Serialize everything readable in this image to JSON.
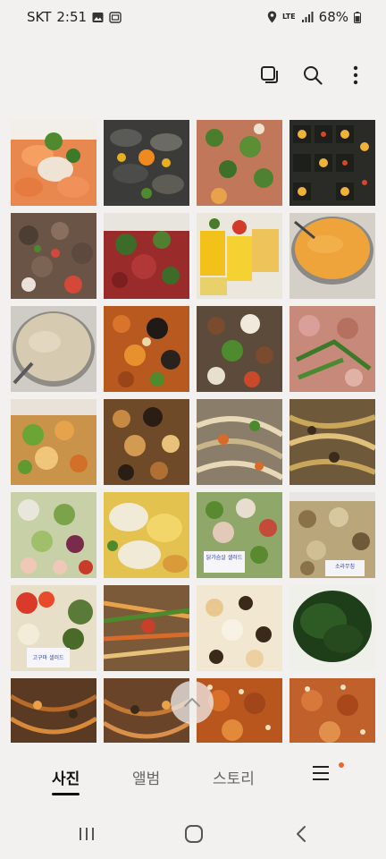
{
  "status": {
    "carrier": "SKT",
    "time": "2:51",
    "network": "LTE",
    "battery": "68%"
  },
  "toolbar": {
    "icons": [
      "select-icon",
      "search-icon",
      "more-options-icon"
    ]
  },
  "photos": [
    {
      "labels": []
    },
    {
      "labels": []
    },
    {
      "labels": []
    },
    {
      "labels": []
    },
    {
      "labels": []
    },
    {
      "labels": []
    },
    {
      "labels": []
    },
    {
      "labels": []
    },
    {
      "labels": []
    },
    {
      "labels": []
    },
    {
      "labels": []
    },
    {
      "labels": []
    },
    {
      "labels": []
    },
    {
      "labels": []
    },
    {
      "labels": []
    },
    {
      "labels": []
    },
    {
      "labels": []
    },
    {
      "labels": []
    },
    {
      "labels": [
        "닭가슴살 샐러드"
      ]
    },
    {
      "labels": [
        "소라무침"
      ]
    },
    {
      "labels": [
        "고구마 샐러드"
      ]
    },
    {
      "labels": []
    },
    {
      "labels": []
    },
    {
      "labels": []
    },
    {
      "labels": []
    },
    {
      "labels": []
    },
    {
      "labels": []
    },
    {
      "labels": []
    }
  ],
  "tabs": {
    "photos": "사진",
    "albums": "앨범",
    "stories": "스토리"
  },
  "colors": {
    "accent_dot": "#e8682e",
    "background": "#f3f1ef"
  }
}
